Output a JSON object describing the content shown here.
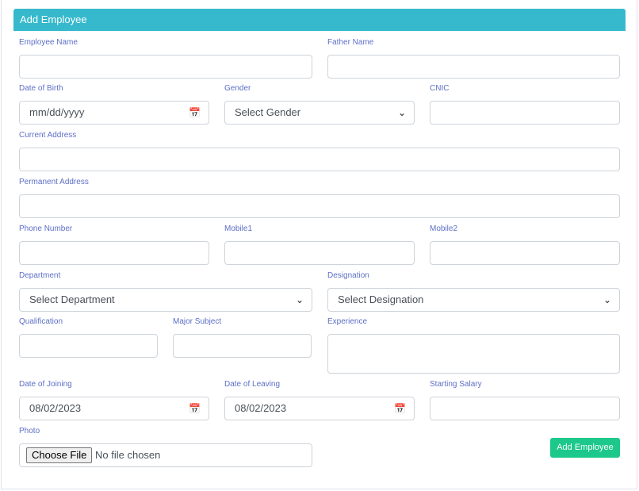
{
  "title": "Add Employee",
  "labels": {
    "employee_name": "Employee Name",
    "father_name": "Father Name",
    "dob": "Date of Birth",
    "gender": "Gender",
    "cnic": "CNIC",
    "current_address": "Current Address",
    "permanent_address": "Permanent Address",
    "phone": "Phone Number",
    "mobile1": "Mobile1",
    "mobile2": "Mobile2",
    "department": "Department",
    "designation": "Designation",
    "qualification": "Qualification",
    "major": "Major Subject",
    "experience": "Experience",
    "doj": "Date of Joining",
    "dol": "Date of Leaving",
    "salary": "Starting Salary",
    "photo": "Photo"
  },
  "values": {
    "dob": "mm/dd/yyyy",
    "gender": "Select Gender",
    "department": "Select Department",
    "designation": "Select Designation",
    "doj": "08/02/2023",
    "dol": "08/02/2023",
    "choose_file": "Choose File",
    "no_file": "No file chosen"
  },
  "submit": "Add Employee"
}
